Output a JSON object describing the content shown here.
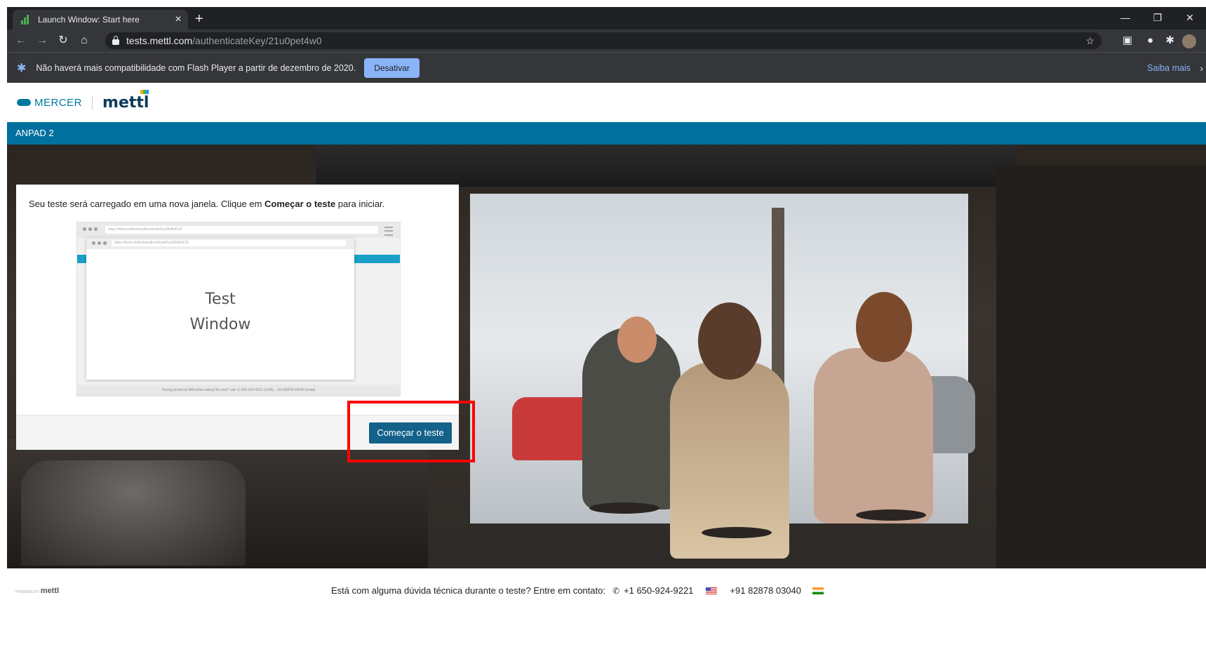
{
  "browser": {
    "tab_title": "Launch Window: Start here",
    "new_tab": "+",
    "url_host": "tests.mettl.com",
    "url_path": "/authenticateKey/21u0pet4w0"
  },
  "infobar": {
    "message": "Não haverá mais compatibilidade com Flash Player a partir de dezembro de 2020.",
    "button_label": "Desativar",
    "learn_more": "Saiba mais"
  },
  "brand": {
    "mercer": "MERCER",
    "mettl": "mettl"
  },
  "page": {
    "section_title": "ANPAD 2"
  },
  "card": {
    "message_prefix": "Seu teste será carregado em uma nova janela. Clique em ",
    "message_bold": "Começar o teste",
    "message_suffix": " para iniciar.",
    "preview_url_outer": "https://tests.mettl.de/authenticateKey/3b4b4136",
    "preview_url_inner": "https://tests.mettl.de/authenticateKey/3b4b4136",
    "preview_text_line1": "Test",
    "preview_text_line2": "Window",
    "preview_footer": "Facing technical difficulties taking this test? call +1-650-924-9221 (USA) , +91-82878-03040 (India)",
    "start_button": "Começar o teste"
  },
  "footer": {
    "powered_by": "POWERED BY",
    "powered_brand": "mettl",
    "help_text": "Está com alguma dúvida técnica durante o teste? Entre em contato:",
    "phone_us": "+1 650-924-9221",
    "phone_in": "+91 82878 03040"
  },
  "colors": {
    "brand_blue": "#00709e",
    "button_blue": "#14628a",
    "highlight_red": "#ff0000",
    "chrome_dark": "#202124"
  }
}
